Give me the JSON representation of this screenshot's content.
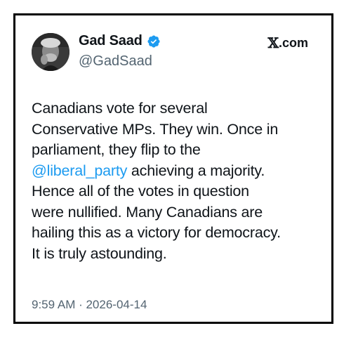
{
  "tweet": {
    "author": {
      "display_name": "Gad Saad",
      "handle": "@GadSaad",
      "verified_icon": "verified-badge-icon",
      "avatar_icon": "profile-avatar"
    },
    "source": {
      "logo": "𝕏",
      "label": ".com"
    },
    "body_lines": [
      {
        "text": "Canadians vote for several"
      },
      {
        "text": "Conservative MPs. They win. Once in"
      },
      {
        "text": "parliament, they flip to the"
      },
      {
        "mention": "@liberal_party",
        "text": " achieving a majority."
      },
      {
        "text": "Hence all of the votes in question"
      },
      {
        "text": "were nullified. Many Canadians are"
      },
      {
        "text": "hailing this as a victory for democracy."
      },
      {
        "text": "It is truly astounding."
      }
    ],
    "timestamp": "9:59 AM · 2026-04-14"
  },
  "colors": {
    "text": "#0f1419",
    "secondary": "#536471",
    "link": "#1d9bf0",
    "verified": "#1d9bf0",
    "border": "#000000"
  }
}
